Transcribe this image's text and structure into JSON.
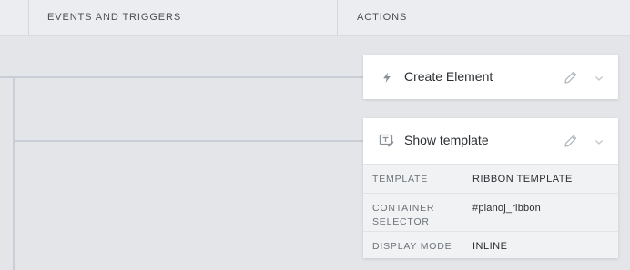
{
  "header": {
    "events_label": "EVENTS AND TRIGGERS",
    "actions_label": "ACTIONS"
  },
  "actions": [
    {
      "title": "Create Element",
      "icon": "lightning-icon"
    },
    {
      "title": "Show template",
      "icon": "template-edit-icon",
      "properties": [
        {
          "key": "TEMPLATE",
          "value": "RIBBON TEMPLATE"
        },
        {
          "key": "CONTAINER SELECTOR",
          "value": "#pianoj_ribbon"
        },
        {
          "key": "DISPLAY MODE",
          "value": "INLINE"
        }
      ]
    }
  ],
  "colors": {
    "background": "#e3e5e8",
    "header": "#ebedf0",
    "connector": "#c8cdd6",
    "card": "#ffffff",
    "properties_panel": "#f1f2f4"
  }
}
